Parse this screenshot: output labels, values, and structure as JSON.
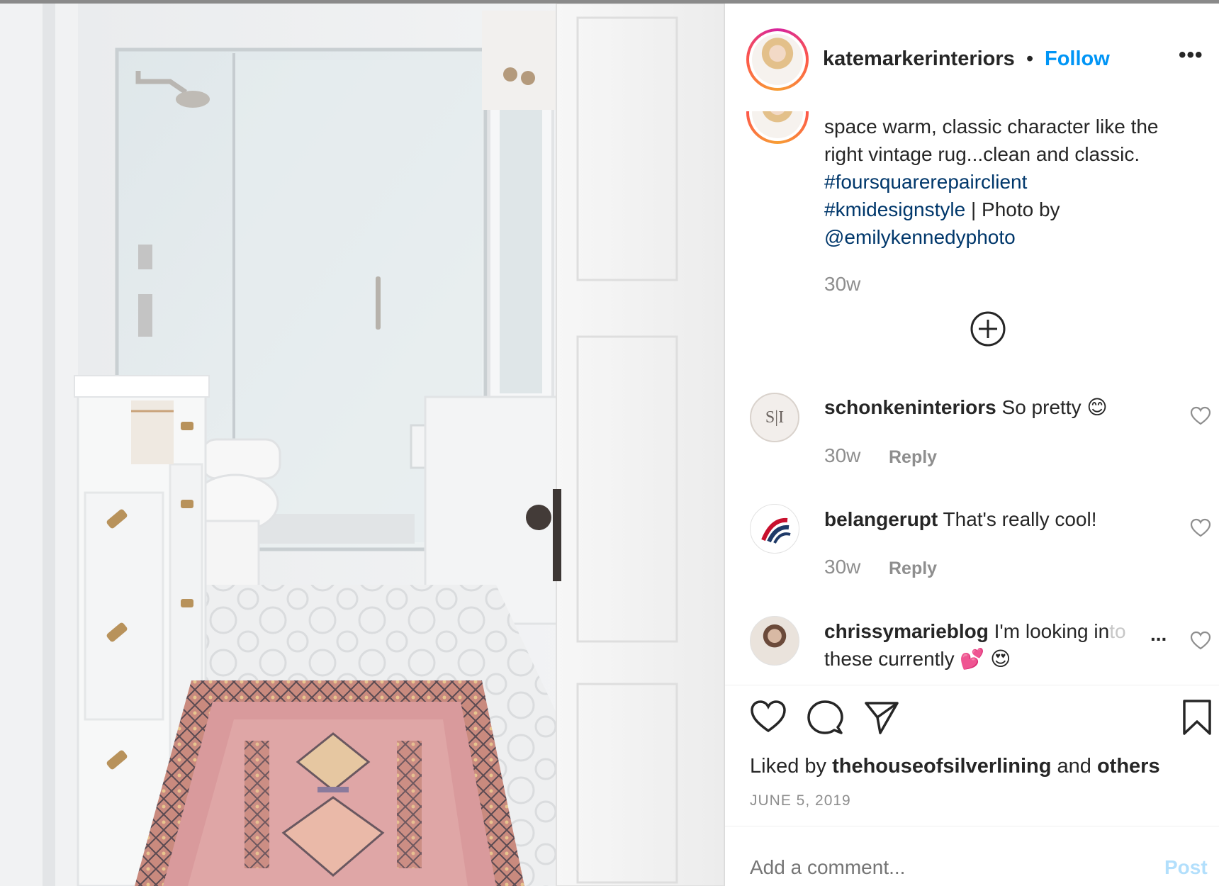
{
  "header": {
    "username": "katemarkerinteriors",
    "separator": "•",
    "follow_label": "Follow",
    "more_label": "•••"
  },
  "post": {
    "caption_line1": "space warm, classic character like the",
    "caption_line2": "right vintage rug...clean and classic.",
    "hashtag1": "#foursquarerepairclient",
    "hashtag2": "#kmidesignstyle",
    "photo_by": " | Photo by",
    "photographer": "@emilykennedyphoto",
    "time": "30w"
  },
  "comments": [
    {
      "username": "schonkeninteriors",
      "text": "So pretty",
      "emoji": "😊",
      "time": "30w",
      "reply_label": "Reply",
      "avatar_text": "S|I"
    },
    {
      "username": "belangerupt",
      "text": "That's really cool!",
      "emoji": "",
      "time": "30w",
      "reply_label": "Reply"
    },
    {
      "username": "chrissymarieblog",
      "text": "I'm looking in",
      "text_fade": "to",
      "more": "...",
      "text_line2": "these currently",
      "emoji1": "💕",
      "emoji2": "😍"
    }
  ],
  "actions": {
    "liked_prefix": "Liked by ",
    "liked_user": "thehouseofsilverlining",
    "liked_middle": " and ",
    "liked_others": "others",
    "date": "JUNE 5, 2019"
  },
  "comment_box": {
    "placeholder": "Add a comment...",
    "post_label": "Post"
  },
  "colors": {
    "accent": "#0095f6",
    "hashtag": "#00376b",
    "muted": "#8e8e8e",
    "rug": "#d99a9c"
  },
  "icons": [
    "more-icon",
    "add-replies-icon",
    "heart-icon",
    "comment-icon",
    "share-icon",
    "save-icon"
  ]
}
